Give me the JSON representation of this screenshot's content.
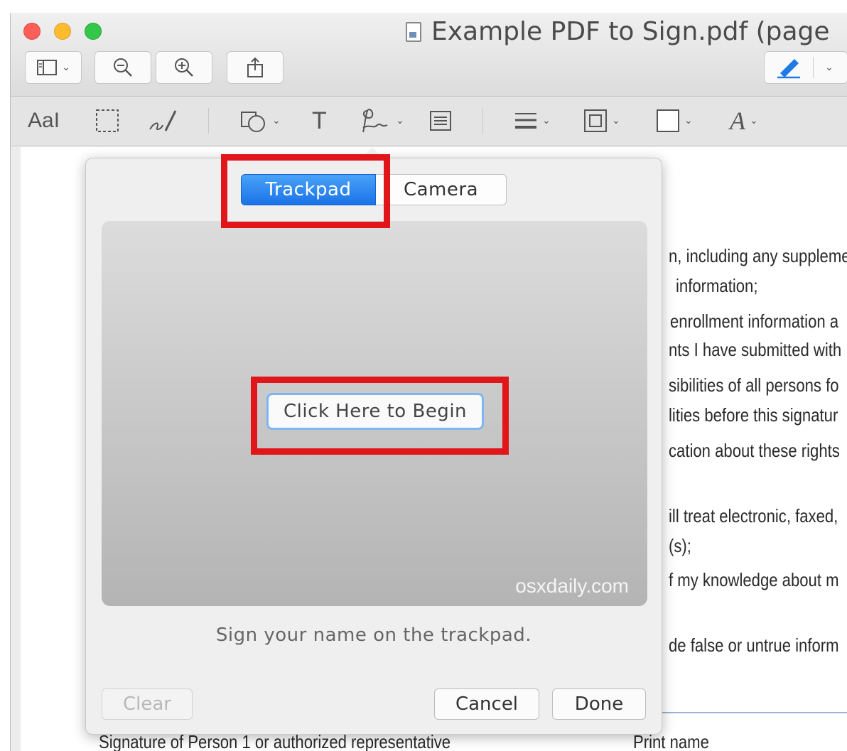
{
  "window": {
    "title": "Example PDF to Sign.pdf (page"
  },
  "toolbar": {
    "sidebar_icon": "sidebar-icon",
    "zoom_out_icon": "zoom-out-icon",
    "zoom_in_icon": "zoom-in-icon",
    "share_icon": "share-icon",
    "markup_icon": "pen-icon"
  },
  "markup_tools": [
    "text-style-icon",
    "selection-icon",
    "sketch-icon",
    "shapes-icon",
    "text-icon",
    "signature-icon",
    "note-icon",
    "line-style-icon",
    "border-color-icon",
    "fill-color-icon",
    "font-icon"
  ],
  "markup_labels": {
    "text_style": "AaI",
    "text": "T",
    "font": "A"
  },
  "popover": {
    "tabs": [
      {
        "label": "Trackpad",
        "selected": true
      },
      {
        "label": "Camera",
        "selected": false
      }
    ],
    "begin_label": "Click Here to Begin",
    "watermark": "osxdaily.com",
    "hint": "Sign your name on the trackpad.",
    "clear_label": "Clear",
    "cancel_label": "Cancel",
    "done_label": "Done"
  },
  "pdf": {
    "lines": [
      "n, including any suppleme",
      "information;",
      "enrollment information a",
      "nts I have submitted with",
      "sibilities of all persons fo",
      "lities before this signatur",
      "cation about these rights",
      "ill treat electronic, faxed,",
      "(s);",
      "f my knowledge about m",
      "de false or untrue inform"
    ],
    "footer_left": "Signature of Person 1 or authorized representative",
    "footer_right": "Print name"
  },
  "colors": {
    "accent": "#1a73e8",
    "highlight": "#e0161b"
  }
}
